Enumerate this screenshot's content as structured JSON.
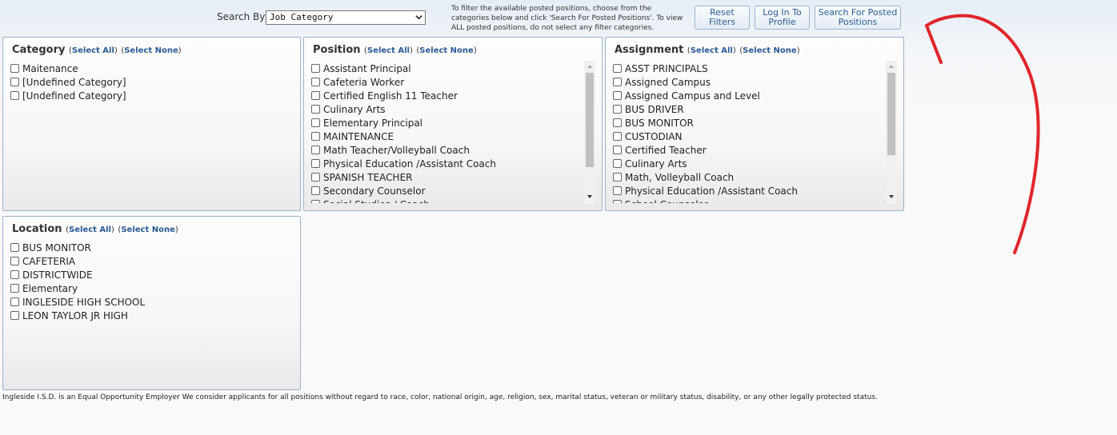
{
  "search": {
    "label": "Search By:",
    "selected": "Job Category"
  },
  "help_text": "To filter the available posted positions, choose from the categories below and click 'Search For Posted Positions'. To view ALL posted positions, do not select any filter categories.",
  "buttons": {
    "reset_line1": "Reset",
    "reset_line2": "Filters",
    "login_line1": "Log In To",
    "login_line2": "Profile",
    "search_line1": "Search For Posted",
    "search_line2": "Positions"
  },
  "links": {
    "select_all": "Select All",
    "select_none": "Select None"
  },
  "panels": {
    "category": {
      "title": "Category",
      "items": [
        "Maitenance",
        "[Undefined Category]",
        "[Undefined Category]"
      ]
    },
    "position": {
      "title": "Position",
      "items": [
        "Assistant Principal",
        "Cafeteria Worker",
        "Certified English 11 Teacher",
        "Culinary Arts",
        "Elementary Principal",
        "MAINTENANCE",
        "Math Teacher/Volleyball Coach",
        "Physical Education /Assistant Coach",
        "SPANISH TEACHER",
        "Secondary Counselor",
        "Social Studies / Coach"
      ]
    },
    "assignment": {
      "title": "Assignment",
      "items": [
        "ASST PRINCIPALS",
        "Assigned Campus",
        "Assigned Campus and Level",
        "BUS DRIVER",
        "BUS MONITOR",
        "CUSTODIAN",
        "Certified Teacher",
        "Culinary Arts",
        "Math, Volleyball Coach",
        "Physical Education /Assistant Coach",
        "School Counselor"
      ]
    },
    "location": {
      "title": "Location",
      "items": [
        "BUS MONITOR",
        "CAFETERIA",
        "DISTRICTWIDE",
        "Elementary",
        "INGLESIDE HIGH SCHOOL",
        "LEON TAYLOR JR HIGH"
      ]
    }
  },
  "footer": "Ingleside I.S.D. is an Equal Opportunity Employer We consider applicants for all positions without regard to race, color, national origin, age, religion, sex, marital status, veteran or military status, disability, or any other legally protected status.",
  "icons": {
    "dropdown": "chevron-down-icon",
    "scroll_up": "scroll-up-arrow-icon",
    "scroll_down": "scroll-down-arrow-icon",
    "annotation": "red-curved-arrow-annotation"
  },
  "colors": {
    "link": "#2a5a96",
    "panel_border": "#9bb2cb",
    "annotation": "#e0252b"
  }
}
